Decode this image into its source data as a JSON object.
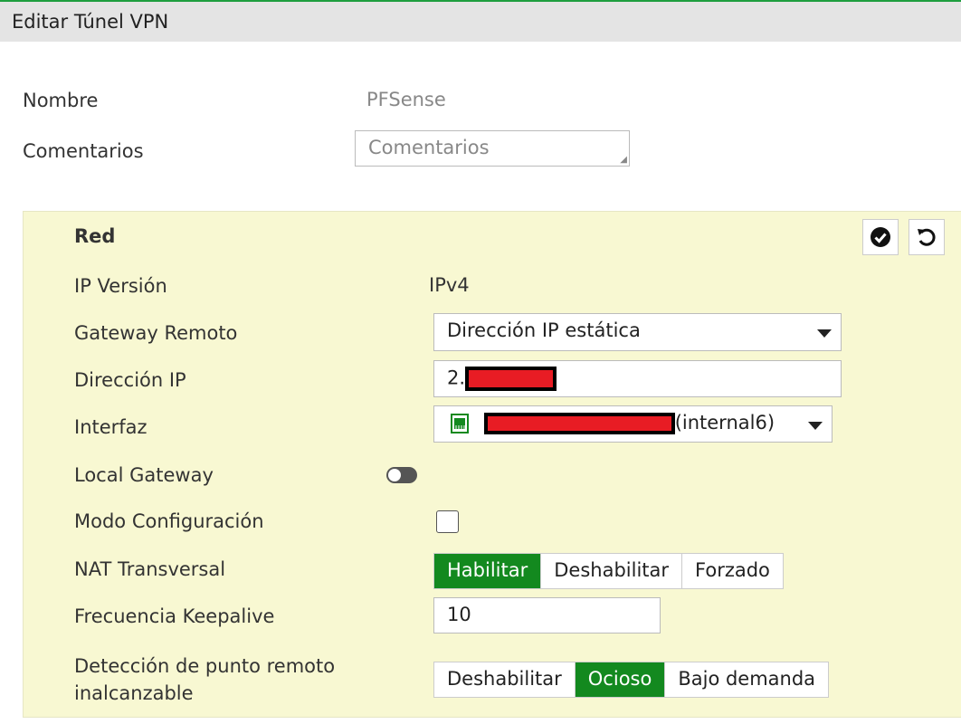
{
  "header": {
    "title": "Editar Túnel VPN"
  },
  "form": {
    "name_label": "Nombre",
    "name_value": "PFSense",
    "comments_label": "Comentarios",
    "comments_placeholder": "Comentarios"
  },
  "network": {
    "section_title": "Red",
    "ip_version_label": "IP Versión",
    "ip_version_value": "IPv4",
    "remote_gateway_label": "Gateway Remoto",
    "remote_gateway_value": "Dirección IP estática",
    "ip_address_label": "Dirección IP",
    "ip_address_prefix": "2.",
    "interface_label": "Interfaz",
    "interface_suffix": "(internal6)",
    "local_gateway_label": "Local Gateway",
    "local_gateway_enabled": false,
    "mode_config_label": "Modo Configuración",
    "mode_config_checked": false,
    "nat_label": "NAT Transversal",
    "nat_options": [
      "Habilitar",
      "Deshabilitar",
      "Forzado"
    ],
    "nat_selected": "Habilitar",
    "keepalive_label": "Frecuencia Keepalive",
    "keepalive_value": "10",
    "dpd_label_1": "Detección de punto remoto",
    "dpd_label_2": "inalcanzable",
    "dpd_options": [
      "Deshabilitar",
      "Ocioso",
      "Bajo demanda"
    ],
    "dpd_selected": "Ocioso"
  },
  "colors": {
    "accent": "#13891f",
    "panel": "#f8f8d2",
    "redaction": "#e81c24"
  }
}
